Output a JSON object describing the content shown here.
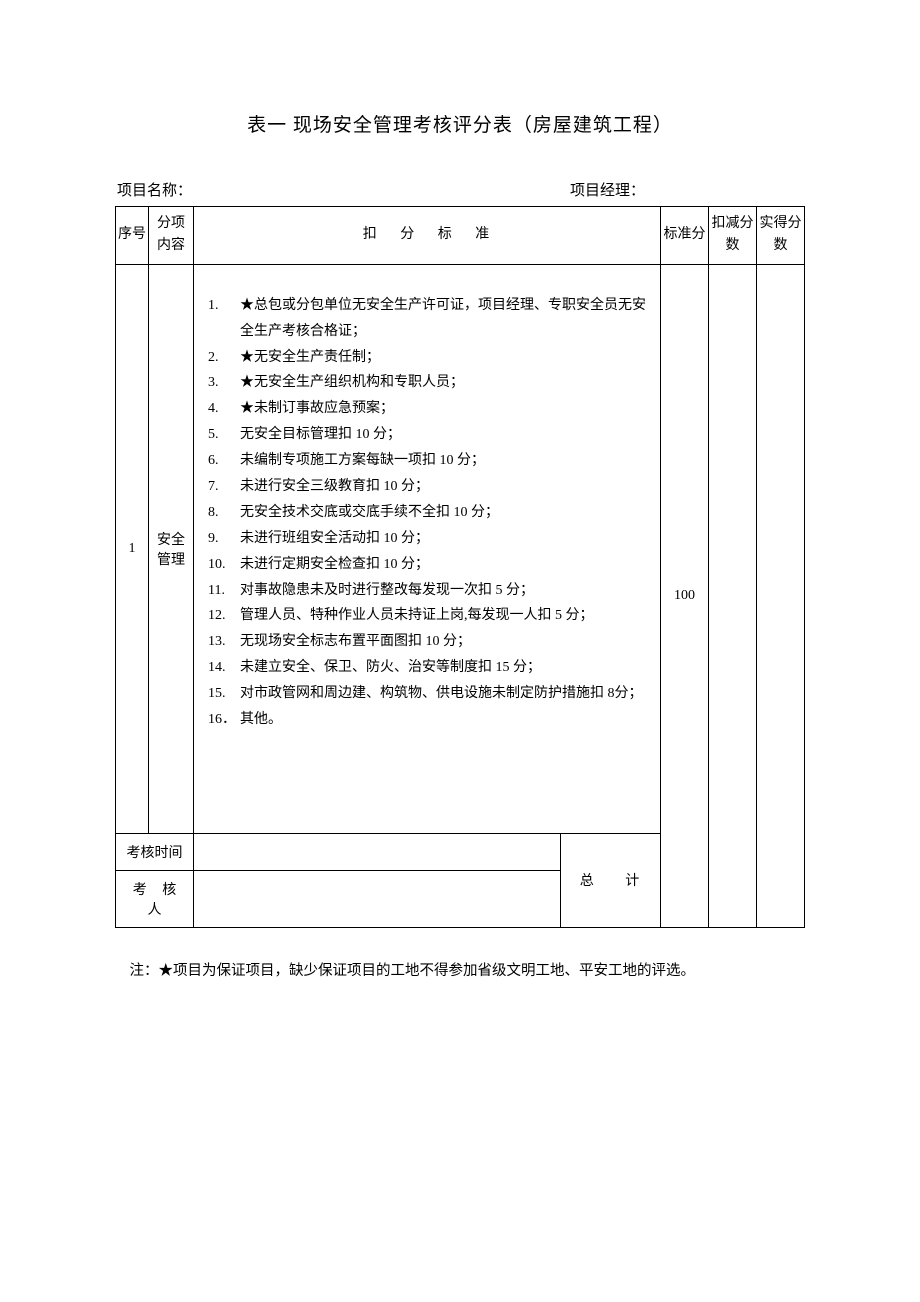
{
  "title": "表一 现场安全管理考核评分表（房屋建筑工程）",
  "header": {
    "project_name_label": "项目名称：",
    "project_manager_label": "项目经理："
  },
  "columns": {
    "seq": "序号",
    "category": "分项内容",
    "criteria": "扣 分 标 准",
    "standard": "标准分",
    "deduction": "扣减分数",
    "actual": "实得分数"
  },
  "row": {
    "seq": "1",
    "category": "安全管理",
    "items": [
      {
        "num": "1.",
        "txt": "★总包或分包单位无安全生产许可证，项目经理、专职安全员无安全生产考核合格证；"
      },
      {
        "num": "2.",
        "txt": "★无安全生产责任制；"
      },
      {
        "num": "3.",
        "txt": "★无安全生产组织机构和专职人员；"
      },
      {
        "num": "4.",
        "txt": "★未制订事故应急预案；"
      },
      {
        "num": "5.",
        "txt": "无安全目标管理扣 10 分；"
      },
      {
        "num": "6.",
        "txt": "未编制专项施工方案每缺一项扣 10 分；"
      },
      {
        "num": "7.",
        "txt": "未进行安全三级教育扣 10 分；"
      },
      {
        "num": "8.",
        "txt": "无安全技术交底或交底手续不全扣 10 分；"
      },
      {
        "num": "9.",
        "txt": "未进行班组安全活动扣 10 分；"
      },
      {
        "num": "10.",
        "txt": "未进行定期安全检查扣 10 分；"
      },
      {
        "num": "11.",
        "txt": "对事故隐患未及时进行整改每发现一次扣 5 分；"
      },
      {
        "num": "12.",
        "txt": "管理人员、特种作业人员未持证上岗,每发现一人扣 5 分；"
      },
      {
        "num": "13.",
        "txt": "无现场安全标志布置平面图扣 10 分；"
      },
      {
        "num": "14.",
        "txt": "未建立安全、保卫、防火、治安等制度扣 15 分；"
      },
      {
        "num": "15.",
        "txt": "对市政管网和周边建、构筑物、供电设施未制定防护措施扣 8分；"
      },
      {
        "num": "16．",
        "txt": "其他。"
      }
    ]
  },
  "footer": {
    "assess_time_label": "考核时间",
    "assessor_label": "考 核 人",
    "total_label": "总 计",
    "total_value": "100"
  },
  "note": "注：★项目为保证项目，缺少保证项目的工地不得参加省级文明工地、平安工地的评选。"
}
